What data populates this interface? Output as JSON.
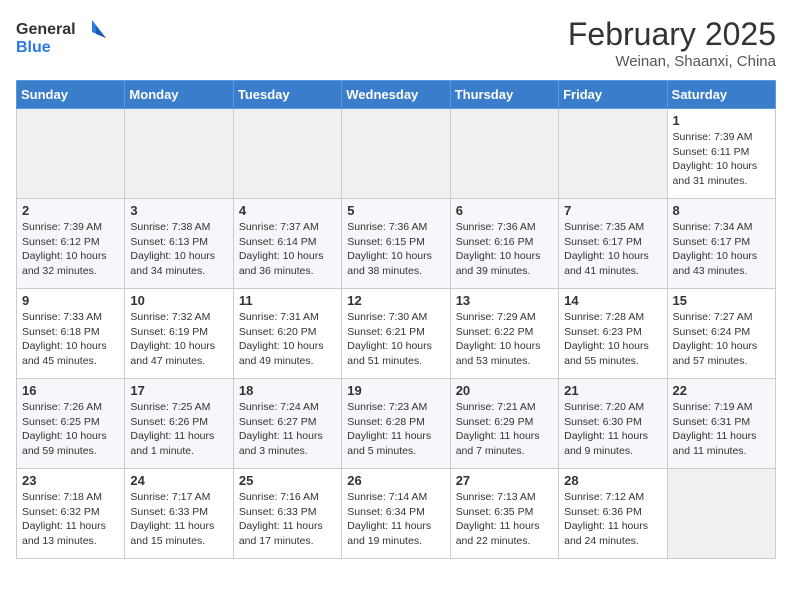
{
  "header": {
    "logo_line1": "General",
    "logo_line2": "Blue",
    "month": "February 2025",
    "location": "Weinan, Shaanxi, China"
  },
  "weekdays": [
    "Sunday",
    "Monday",
    "Tuesday",
    "Wednesday",
    "Thursday",
    "Friday",
    "Saturday"
  ],
  "weeks": [
    [
      {
        "day": "",
        "info": ""
      },
      {
        "day": "",
        "info": ""
      },
      {
        "day": "",
        "info": ""
      },
      {
        "day": "",
        "info": ""
      },
      {
        "day": "",
        "info": ""
      },
      {
        "day": "",
        "info": ""
      },
      {
        "day": "1",
        "info": "Sunrise: 7:39 AM\nSunset: 6:11 PM\nDaylight: 10 hours and 31 minutes."
      }
    ],
    [
      {
        "day": "2",
        "info": "Sunrise: 7:39 AM\nSunset: 6:12 PM\nDaylight: 10 hours and 32 minutes."
      },
      {
        "day": "3",
        "info": "Sunrise: 7:38 AM\nSunset: 6:13 PM\nDaylight: 10 hours and 34 minutes."
      },
      {
        "day": "4",
        "info": "Sunrise: 7:37 AM\nSunset: 6:14 PM\nDaylight: 10 hours and 36 minutes."
      },
      {
        "day": "5",
        "info": "Sunrise: 7:36 AM\nSunset: 6:15 PM\nDaylight: 10 hours and 38 minutes."
      },
      {
        "day": "6",
        "info": "Sunrise: 7:36 AM\nSunset: 6:16 PM\nDaylight: 10 hours and 39 minutes."
      },
      {
        "day": "7",
        "info": "Sunrise: 7:35 AM\nSunset: 6:17 PM\nDaylight: 10 hours and 41 minutes."
      },
      {
        "day": "8",
        "info": "Sunrise: 7:34 AM\nSunset: 6:17 PM\nDaylight: 10 hours and 43 minutes."
      }
    ],
    [
      {
        "day": "9",
        "info": "Sunrise: 7:33 AM\nSunset: 6:18 PM\nDaylight: 10 hours and 45 minutes."
      },
      {
        "day": "10",
        "info": "Sunrise: 7:32 AM\nSunset: 6:19 PM\nDaylight: 10 hours and 47 minutes."
      },
      {
        "day": "11",
        "info": "Sunrise: 7:31 AM\nSunset: 6:20 PM\nDaylight: 10 hours and 49 minutes."
      },
      {
        "day": "12",
        "info": "Sunrise: 7:30 AM\nSunset: 6:21 PM\nDaylight: 10 hours and 51 minutes."
      },
      {
        "day": "13",
        "info": "Sunrise: 7:29 AM\nSunset: 6:22 PM\nDaylight: 10 hours and 53 minutes."
      },
      {
        "day": "14",
        "info": "Sunrise: 7:28 AM\nSunset: 6:23 PM\nDaylight: 10 hours and 55 minutes."
      },
      {
        "day": "15",
        "info": "Sunrise: 7:27 AM\nSunset: 6:24 PM\nDaylight: 10 hours and 57 minutes."
      }
    ],
    [
      {
        "day": "16",
        "info": "Sunrise: 7:26 AM\nSunset: 6:25 PM\nDaylight: 10 hours and 59 minutes."
      },
      {
        "day": "17",
        "info": "Sunrise: 7:25 AM\nSunset: 6:26 PM\nDaylight: 11 hours and 1 minute."
      },
      {
        "day": "18",
        "info": "Sunrise: 7:24 AM\nSunset: 6:27 PM\nDaylight: 11 hours and 3 minutes."
      },
      {
        "day": "19",
        "info": "Sunrise: 7:23 AM\nSunset: 6:28 PM\nDaylight: 11 hours and 5 minutes."
      },
      {
        "day": "20",
        "info": "Sunrise: 7:21 AM\nSunset: 6:29 PM\nDaylight: 11 hours and 7 minutes."
      },
      {
        "day": "21",
        "info": "Sunrise: 7:20 AM\nSunset: 6:30 PM\nDaylight: 11 hours and 9 minutes."
      },
      {
        "day": "22",
        "info": "Sunrise: 7:19 AM\nSunset: 6:31 PM\nDaylight: 11 hours and 11 minutes."
      }
    ],
    [
      {
        "day": "23",
        "info": "Sunrise: 7:18 AM\nSunset: 6:32 PM\nDaylight: 11 hours and 13 minutes."
      },
      {
        "day": "24",
        "info": "Sunrise: 7:17 AM\nSunset: 6:33 PM\nDaylight: 11 hours and 15 minutes."
      },
      {
        "day": "25",
        "info": "Sunrise: 7:16 AM\nSunset: 6:33 PM\nDaylight: 11 hours and 17 minutes."
      },
      {
        "day": "26",
        "info": "Sunrise: 7:14 AM\nSunset: 6:34 PM\nDaylight: 11 hours and 19 minutes."
      },
      {
        "day": "27",
        "info": "Sunrise: 7:13 AM\nSunset: 6:35 PM\nDaylight: 11 hours and 22 minutes."
      },
      {
        "day": "28",
        "info": "Sunrise: 7:12 AM\nSunset: 6:36 PM\nDaylight: 11 hours and 24 minutes."
      },
      {
        "day": "",
        "info": ""
      }
    ]
  ]
}
